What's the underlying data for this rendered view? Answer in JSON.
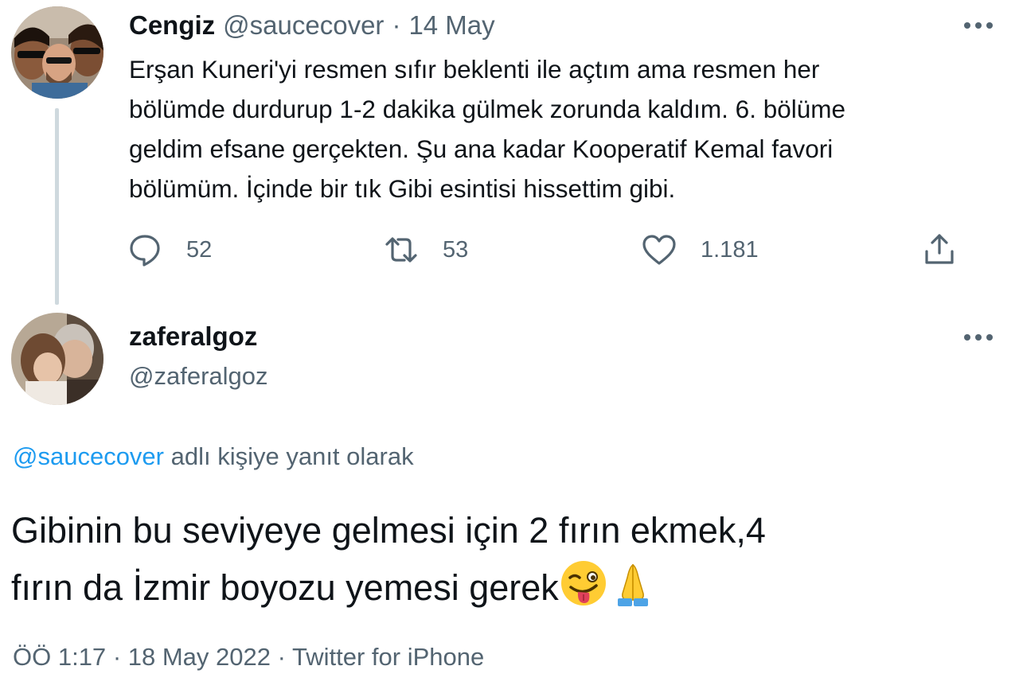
{
  "parent_tweet": {
    "author_name": "Cengiz",
    "author_handle": "@saucecover",
    "separator": "·",
    "date": "14 May",
    "text": "Erşan Kuneri'yi resmen sıfır beklenti ile açtım ama resmen her\nbölümde durdurup 1-2 dakika gülmek zorunda kaldım. 6. bölüme\ngeldim efsane gerçekten. Şu ana kadar Kooperatif Kemal favori\nbölümüm. İçinde bir tık Gibi esintisi hissettim gibi.",
    "actions": {
      "reply_count": "52",
      "retweet_count": "53",
      "like_count": "1.181"
    },
    "icons": {
      "more": "more-horizontal-icon",
      "reply": "reply-icon",
      "retweet": "retweet-icon",
      "like": "heart-icon",
      "share": "share-icon"
    }
  },
  "reply_tweet": {
    "author_name": "zaferalgoz",
    "author_handle": "@zaferalgoz",
    "replying_to_handle": "@saucecover",
    "replying_to_suffix": " adlı kişiye yanıt olarak",
    "text_line1": "Gibinin bu seviyeye gelmesi için 2 fırın ekmek,4",
    "text_line2": "fırın da İzmir boyozu yemesi gerek",
    "emojis": [
      "winking-tongue-face-emoji",
      "folded-hands-emoji"
    ],
    "time": "ÖÖ 1:17",
    "separator": "·",
    "date": "18 May 2022",
    "source": "Twitter for iPhone"
  },
  "colors": {
    "text_primary": "#0f1419",
    "text_secondary": "#536471",
    "link": "#1d9bf0",
    "thread_line": "#cfd9de"
  }
}
